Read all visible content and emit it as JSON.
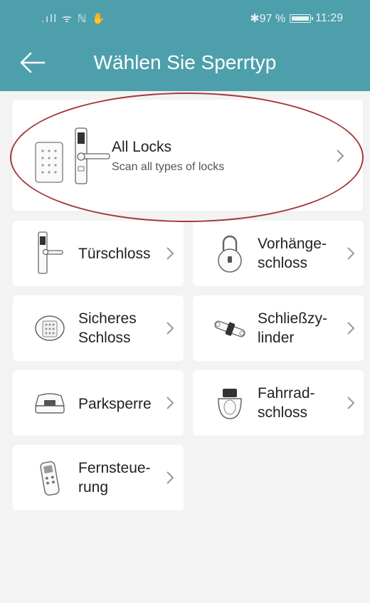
{
  "status_bar": {
    "left_icons": ".ıll ᯤ ℕ ✋",
    "bluetooth_battery": "✱97 %",
    "time": "11:29"
  },
  "header": {
    "title": "Wählen Sie Sperrtyp"
  },
  "all_locks": {
    "title": "All Locks",
    "subtitle": "Scan all types of locks"
  },
  "lock_types": [
    {
      "label": "Türschloss"
    },
    {
      "label": "Vorhänge-\nschloss"
    },
    {
      "label": "Sicheres\nSchloss"
    },
    {
      "label": "Schließzy-\nlinder"
    },
    {
      "label": "Parksperre"
    },
    {
      "label": "Fahrrad-\nschloss"
    },
    {
      "label": "Fernsteue-\nrung"
    }
  ],
  "colors": {
    "header": "#4e9fac",
    "highlight_ellipse": "#a5393b"
  }
}
